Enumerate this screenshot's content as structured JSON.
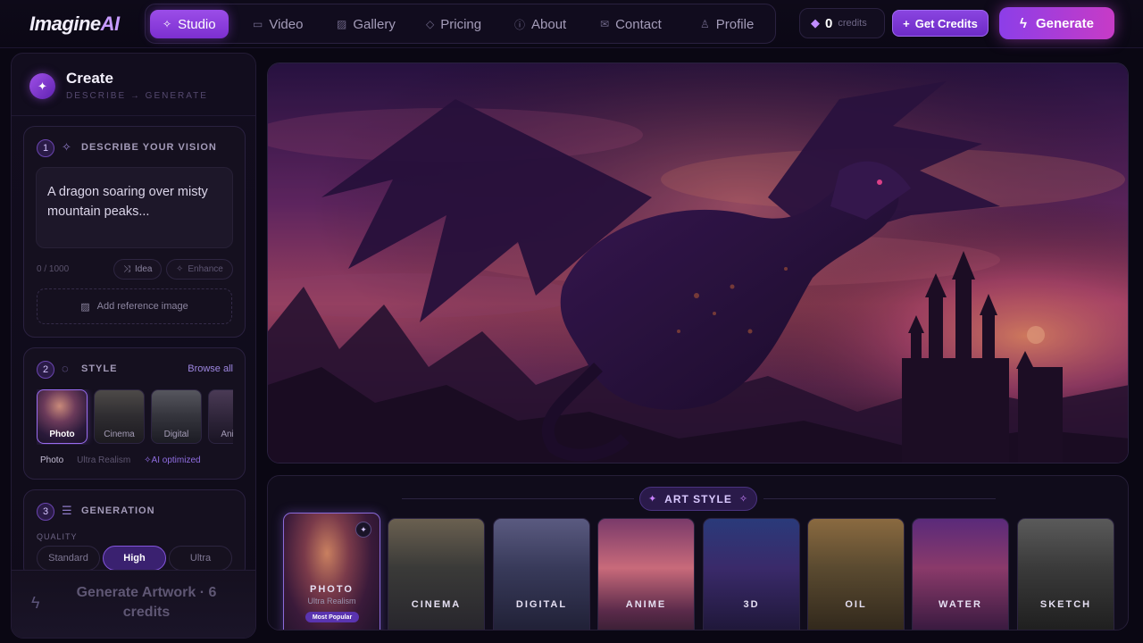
{
  "brand": {
    "name_main": "Imagine",
    "name_accent": "AI"
  },
  "nav": {
    "items": [
      {
        "label": "Studio",
        "icon": "sparkle-icon",
        "glyph": "✧",
        "active": true
      },
      {
        "label": "Video",
        "icon": "film-icon",
        "glyph": "▭",
        "active": false
      },
      {
        "label": "Gallery",
        "icon": "image-icon",
        "glyph": "▨",
        "active": false
      },
      {
        "label": "Pricing",
        "icon": "diamond-icon",
        "glyph": "◇",
        "active": false
      },
      {
        "label": "About",
        "icon": "info-icon",
        "glyph": "ⓘ",
        "active": false
      },
      {
        "label": "Contact",
        "icon": "mail-icon",
        "glyph": "✉",
        "active": false
      },
      {
        "label": "Profile",
        "icon": "user-icon",
        "glyph": "♙",
        "active": false
      }
    ]
  },
  "header": {
    "credits_count": "0",
    "credits_label": "credits",
    "get_credits_label": "Get Credits",
    "generate_label": "Generate"
  },
  "create_panel": {
    "title": "Create",
    "subtitle": "DESCRIBE → GENERATE",
    "step1": {
      "number": "1",
      "title": "DESCRIBE YOUR VISION",
      "prompt_placeholder": "A dragon soaring over misty mountain peaks...",
      "char_count": "0 / 1000",
      "idea_label": "Idea",
      "enhance_label": "Enhance",
      "reference_label": "Add reference image"
    },
    "step2": {
      "number": "2",
      "title": "STYLE",
      "browse_label": "Browse all",
      "thumbs": [
        "Photo",
        "Cinema",
        "Digital",
        "Anime"
      ],
      "selected_name": "Photo",
      "selected_desc": "Ultra Realism",
      "ai_label": "AI optimized"
    },
    "step3": {
      "number": "3",
      "title": "GENERATION",
      "quality_label": "QUALITY",
      "quality_options": [
        "Standard",
        "High",
        "Ultra"
      ],
      "quality_selected": "High"
    },
    "generate_label": "Generate Artwork · 6 credits"
  },
  "art_style": {
    "label": "ART STYLE",
    "cards": [
      {
        "name": "PHOTO",
        "sub": "Ultra Realism",
        "badge": "Most Popular",
        "selected": true
      },
      {
        "name": "CINEMA",
        "selected": false
      },
      {
        "name": "DIGITAL",
        "selected": false
      },
      {
        "name": "ANIME",
        "selected": false
      },
      {
        "name": "3D",
        "selected": false
      },
      {
        "name": "OIL",
        "selected": false
      },
      {
        "name": "WATER",
        "selected": false
      },
      {
        "name": "SKETCH",
        "selected": false
      }
    ]
  },
  "colors": {
    "accent": "#8c3ee8",
    "accent_pink": "#c73bc6",
    "bg": "#0a0713"
  }
}
